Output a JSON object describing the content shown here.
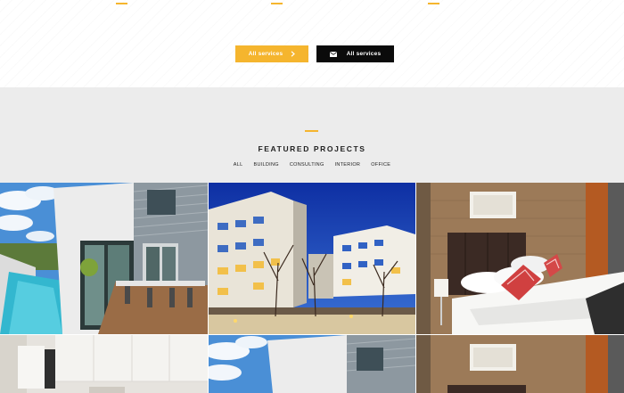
{
  "colors": {
    "accent": "#f5b52e",
    "dark_button": "#0b0b0b",
    "section_bg": "#ececec"
  },
  "buttons": {
    "primary": {
      "label": "All services",
      "icon": "chevron-right-icon"
    },
    "secondary": {
      "label": "All services",
      "icon": "envelope-icon"
    }
  },
  "featured": {
    "title": "FEATURED PROJECTS",
    "filters": [
      "ALL",
      "BUILDING",
      "CONSULTING",
      "INTERIOR",
      "OFFICE"
    ]
  }
}
